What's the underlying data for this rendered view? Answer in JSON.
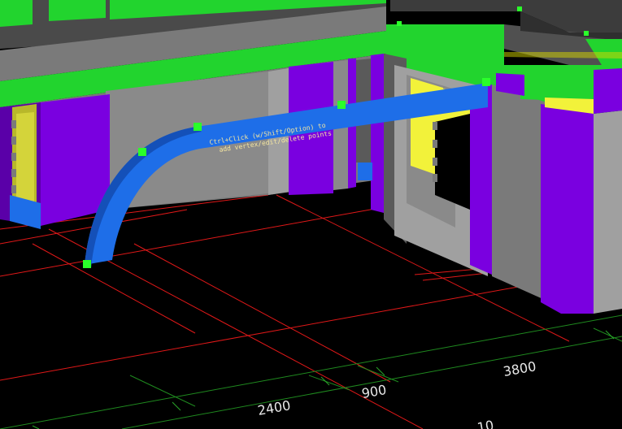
{
  "viewport": {
    "background": "#000000"
  },
  "colors": {
    "wall_gray": "#7a7a7a",
    "wall_gray_light": "#a0a0a0",
    "wall_gray_dark": "#5a5a5a",
    "slab_green": "#22d42e",
    "column_purple": "#7a00e0",
    "column_purple_dark": "#5a00a8",
    "opening_yellow": "#f2f23a",
    "opening_yellow_dark": "#b8b82a",
    "beam_blue": "#1e6ee8",
    "beam_blue_dark": "#1450b8",
    "grip_green": "#2aff2a",
    "grid_red": "#e01818",
    "grid_green": "#1f8a1f"
  },
  "beam": {
    "label_line_1": "Ctrl+Click (w/Shift/Option) to",
    "label_line_2": "add vertex/edit/delete points"
  },
  "dimensions": {
    "d1": "2400",
    "d2": "900",
    "d3": "3800",
    "d4": "10"
  }
}
